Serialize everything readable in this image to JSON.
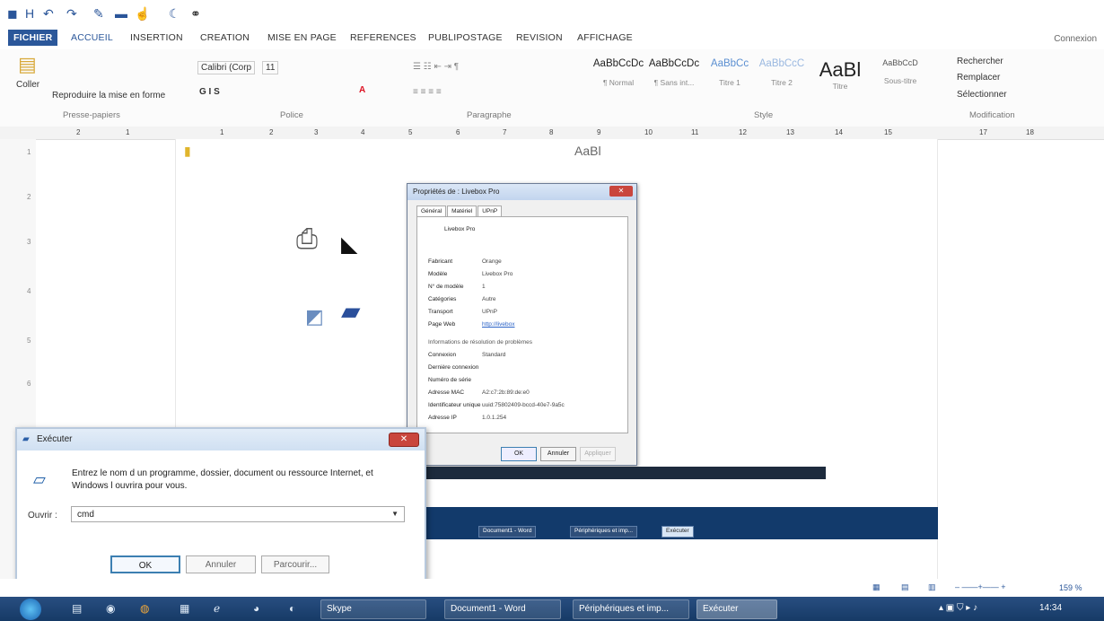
{
  "qat": {
    "items": [
      "word-icon",
      "save-icon",
      "undo-icon",
      "redo-icon",
      "format-painter-icon",
      "open-icon",
      "touch-mode-icon",
      "binoculars-icon"
    ]
  },
  "tabs": [
    "FICHIER",
    "ACCUEIL",
    "INSERTION",
    "CREATION",
    "MISE EN PAGE",
    "REFERENCES",
    "PUBLIPOSTAGE",
    "REVISION",
    "AFFICHAGE"
  ],
  "connexion": "Connexion",
  "ribbon": {
    "paste": "Coller",
    "reproduce": "Reproduire la mise en forme",
    "font_name": "Calibri (Corp",
    "font_size": "11",
    "font_buttons": "G  I  S",
    "styles": [
      {
        "sample": "AaBbCcDc",
        "name": "¶ Normal"
      },
      {
        "sample": "AaBbCcDc",
        "name": "¶ Sans int..."
      },
      {
        "sample": "AaBbCc",
        "name": "Titre 1"
      },
      {
        "sample": "AaBbCcC",
        "name": "Titre 2"
      },
      {
        "sample": "AaBl",
        "name": "Titre"
      },
      {
        "sample": "AaBbCcD",
        "name": "Sous-titre"
      }
    ],
    "find": "Rechercher",
    "replace": "Remplacer",
    "select": "Sélectionner",
    "groups": {
      "clipboard": "Presse-papiers",
      "font": "Police",
      "paragraph": "Paragraphe",
      "styles": "Style",
      "edit": "Modification"
    }
  },
  "ruler": [
    "2",
    "1",
    "1",
    "2",
    "3",
    "4",
    "5",
    "6",
    "7",
    "8",
    "9",
    "10",
    "11",
    "12",
    "13",
    "14",
    "15",
    "17",
    "18"
  ],
  "left_ruler": [
    "1",
    "2",
    "3",
    "4",
    "5",
    "6"
  ],
  "props": {
    "title": "Propriétés de : Livebox Pro",
    "tabs": [
      "Général",
      "Matériel",
      "UPnP"
    ],
    "device": "Livebox Pro",
    "rows": [
      {
        "k": "Fabricant",
        "v": "Orange"
      },
      {
        "k": "Modèle",
        "v": "Livebox Pro"
      },
      {
        "k": "N° de modèle",
        "v": "1"
      },
      {
        "k": "Catégories",
        "v": "Autre"
      },
      {
        "k": "Transport",
        "v": "UPnP"
      },
      {
        "k": "Page Web",
        "v": "http://livebox"
      }
    ],
    "section2": "Informations de résolution de problèmes",
    "rows2": [
      {
        "k": "Connexion",
        "v": "Standard"
      },
      {
        "k": "Dernière connexion",
        "v": ""
      },
      {
        "k": "Numéro de série",
        "v": ""
      },
      {
        "k": "Adresse MAC",
        "v": "A2:c7:2b:89:de:e0"
      },
      {
        "k": "Identificateur unique",
        "v": "uuid:75802409-bccd-40e7-9a5c"
      },
      {
        "k": "Adresse IP",
        "v": "1.0.1.254"
      }
    ],
    "ok": "OK",
    "cancel": "Annuler",
    "apply": "Appliquer"
  },
  "inner_taskbar": [
    "Document1 - Word",
    "Périphériques et imp...",
    "Exécuter"
  ],
  "run": {
    "title": "Exécuter",
    "desc": "Entrez le nom d un programme, dossier, document ou ressource Internet, et Windows l ouvrira pour vous.",
    "label": "Ouvrir :",
    "value": "cmd",
    "ok": "OK",
    "cancel": "Annuler",
    "browse": "Parcourir..."
  },
  "status": {
    "zoom": "159 %"
  },
  "taskbar": {
    "items": [
      "Skype",
      "Document1 - Word",
      "Périphériques et imp...",
      "Exécuter"
    ],
    "clock": "14:34"
  },
  "colors": {
    "accent": "#2b579a",
    "taskbar": "#163a66",
    "close": "#c9463d"
  }
}
